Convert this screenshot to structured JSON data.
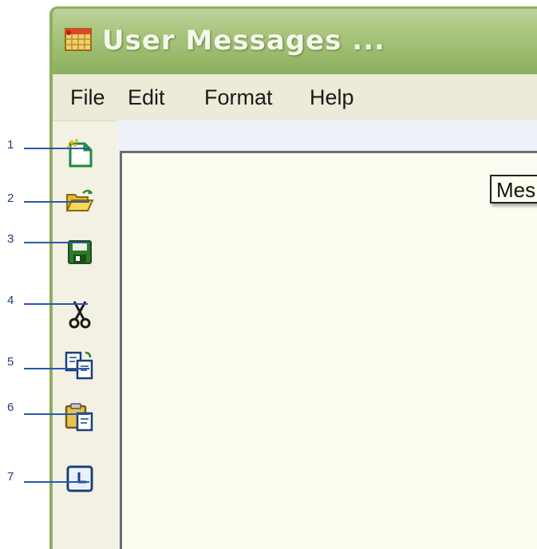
{
  "window": {
    "title": "User Messages ...",
    "app_icon": "calendar-grid-icon"
  },
  "menu": {
    "items": [
      "File",
      "Edit",
      "Format",
      "Help"
    ]
  },
  "toolbar": {
    "buttons": [
      {
        "number": "1",
        "icon": "new-document-icon"
      },
      {
        "number": "2",
        "icon": "open-folder-icon"
      },
      {
        "number": "3",
        "icon": "save-disk-icon"
      },
      {
        "number": "4",
        "icon": "cut-scissors-icon"
      },
      {
        "number": "5",
        "icon": "copy-icon"
      },
      {
        "number": "6",
        "icon": "paste-clipboard-icon"
      },
      {
        "number": "7",
        "icon": "insert-time-icon"
      }
    ]
  },
  "tooltip": {
    "text": "Mes"
  },
  "colors": {
    "titlebar": "#9dbb6f",
    "callout": "#2a56b0",
    "editor_bg": "#fcfcf0"
  }
}
